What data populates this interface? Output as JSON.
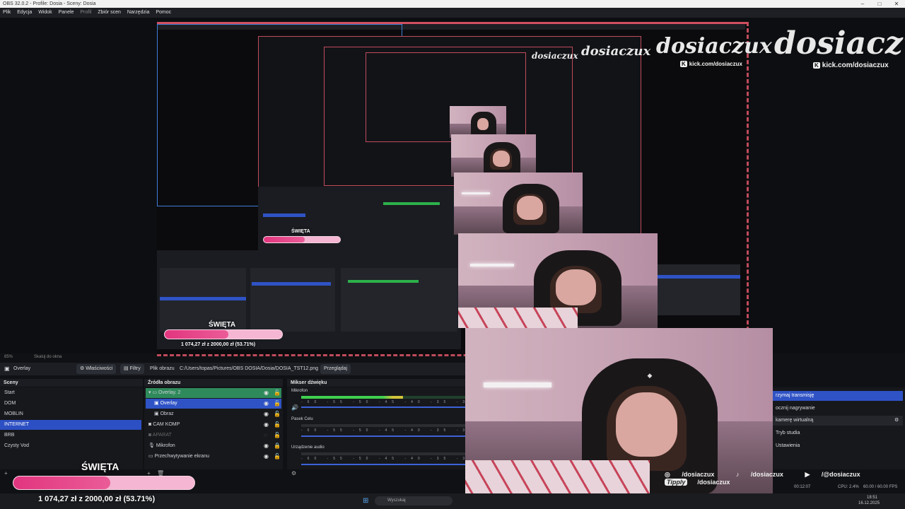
{
  "window": {
    "title": "OBS 32.0.2 - Profile: Dosia - Sceny: Dosia"
  },
  "menu": [
    "Plik",
    "Edycja",
    "Widok",
    "Panele",
    "Profil",
    "Zbiór scen",
    "Narzędzia",
    "Pomoc"
  ],
  "overlay": {
    "logo": "dosiaczux",
    "kick_url": "kick.com/dosiaczux",
    "goal": {
      "title": "ŚWIĘTA",
      "text": "1 074,27 zł z 2000,00 zł (53.71%)",
      "progress": 0.5371
    },
    "social": {
      "instagram": "/dosiaczux",
      "tiktok": "/dosiaczux",
      "youtube": "/@dosiaczux",
      "tippy_label": "Tipply",
      "tippy": "/dosiaczux"
    }
  },
  "preview": {
    "zoom": "85%",
    "hint": "Skaluj do okna"
  },
  "toolbar": {
    "scene_name": "Overlay",
    "properties": "Właściwości",
    "filters": "Filtry",
    "file_label": "Plik obrazu",
    "file_path": "C:/Users/topas/Pictures/OBS DOSIA/Dosia/DOSIA_TST12.png",
    "browse": "Przeglądaj"
  },
  "scenes": {
    "title": "Sceny",
    "items": [
      "Start",
      "DOM",
      "MOBLIN",
      "INTERNET",
      "BRB",
      "Czysty Vod"
    ],
    "selected_index": 3
  },
  "sources": {
    "title": "Źródła obrazu",
    "items": [
      {
        "name": "Overlay. 2",
        "kind": "group"
      },
      {
        "name": "Overlay",
        "kind": "selected"
      },
      {
        "name": "Obraz",
        "kind": "child"
      },
      {
        "name": "CAM KOMP",
        "kind": "normal"
      },
      {
        "name": "APARAT",
        "kind": "hidden"
      },
      {
        "name": "Mikrofon",
        "kind": "normal"
      },
      {
        "name": "Przechwytywanie ekranu",
        "kind": "normal"
      }
    ]
  },
  "mixer": {
    "title": "Mikser dźwięku",
    "channels": [
      {
        "name": "Mikrofon",
        "level": 0.62
      },
      {
        "name": "Pasek Celu",
        "level": 0.0
      },
      {
        "name": "Urządzenie audio",
        "level": 0.0
      }
    ],
    "scale": "-60 -55 -50 -45 -40 -35 -30 -25 -20 -15 -10 -5 0"
  },
  "controls": {
    "items": [
      "rzymaj transmisję",
      "ocznij nagrywanie",
      "kamerę wirtualną",
      "Tryb studia",
      "Ustawienia"
    ],
    "active_index": 0
  },
  "status": {
    "time": "00:12:07",
    "cpu": "CPU: 2.4%",
    "fps": "60.00 / 60.00 FPS"
  },
  "taskbar": {
    "search": "Wyszukaj",
    "clock": "18:51",
    "date": "16.12.2025"
  },
  "colors": {
    "accent": "#2f53c5",
    "group": "#2f8a5b",
    "goal_fill": "#e2357f",
    "goal_bg": "#f4b6d2",
    "border": "#c04b5c"
  }
}
